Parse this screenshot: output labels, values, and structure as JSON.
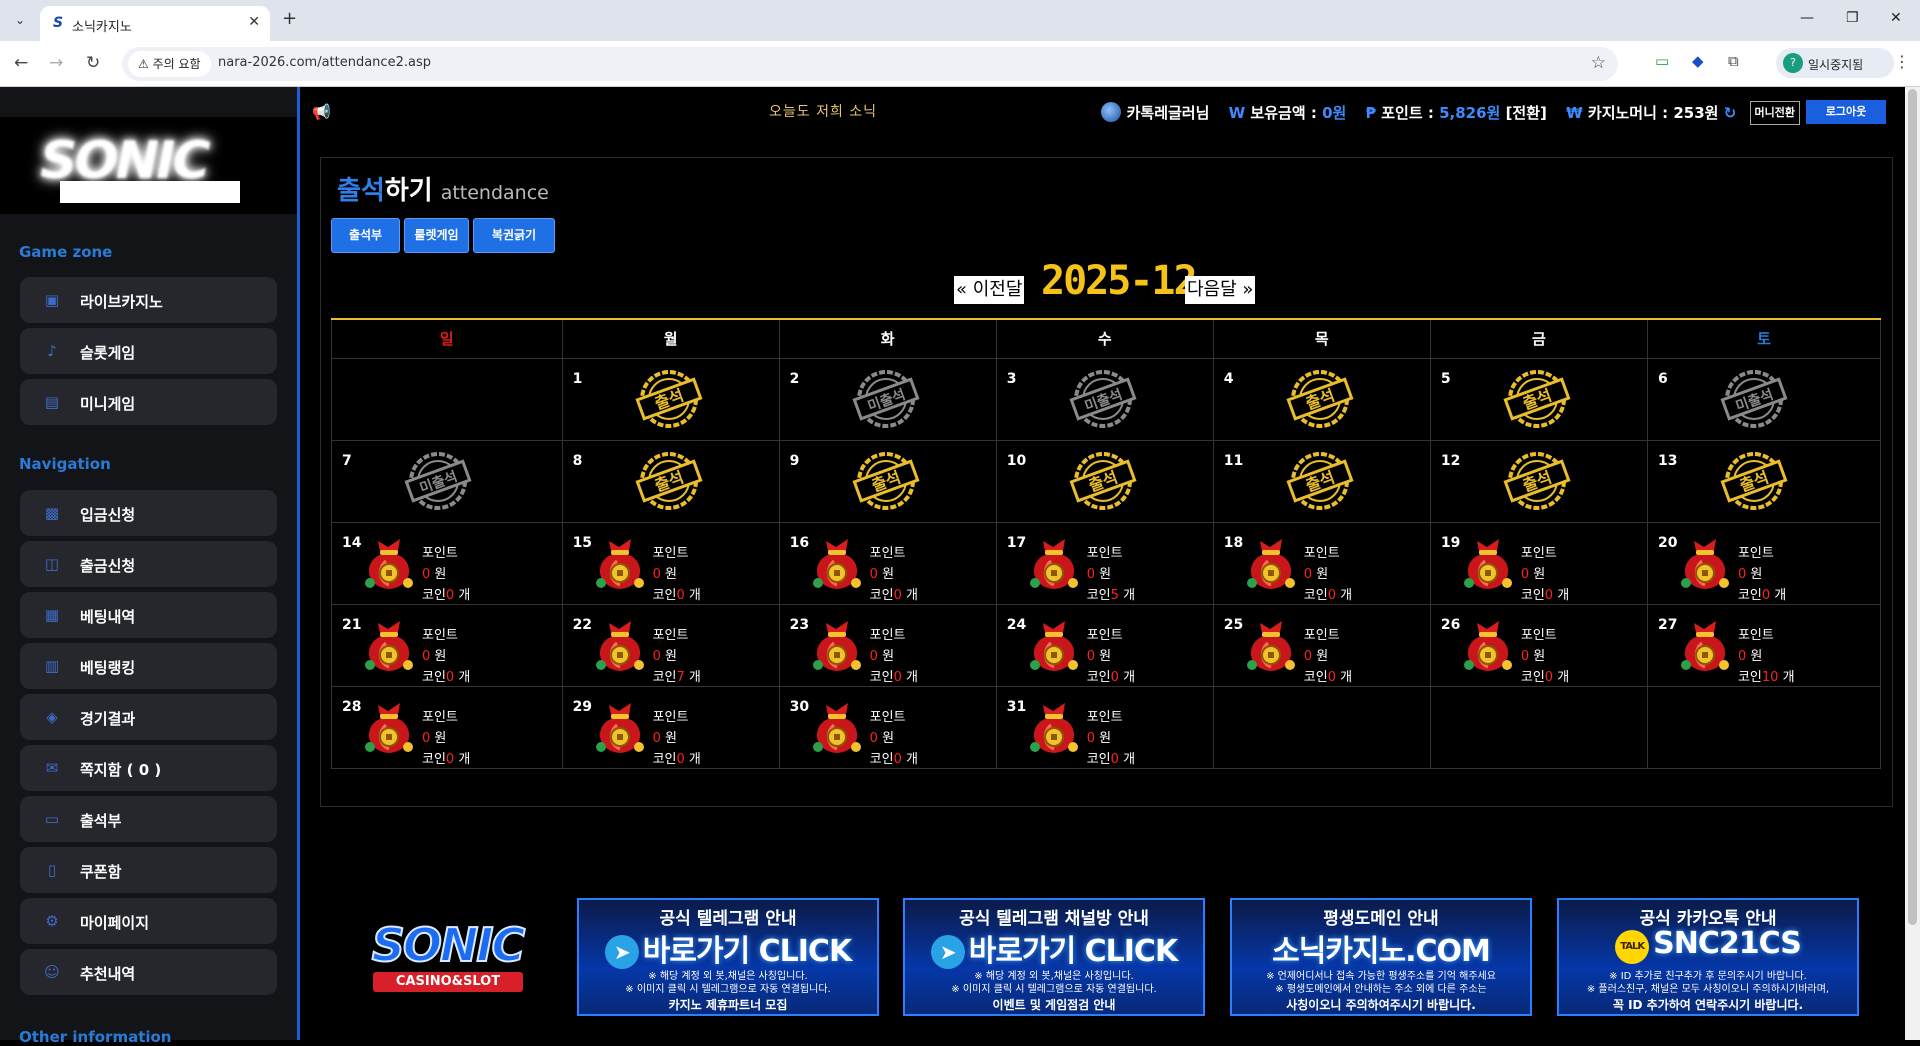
{
  "browser": {
    "tab_title": "소닉카지노",
    "tab_icon": "S",
    "security_chip": "주의 요함",
    "url": "nara-2026.com/attendance2.asp",
    "profile_initial": "?",
    "profile_label": "일시중지됨"
  },
  "topbar": {
    "marquee": "오늘도 저희 소닉",
    "username": "카톡레글러님",
    "balance_label": "보유금액 : ",
    "balance_value": "0원",
    "point_label": "포인트 : ",
    "point_value": "5,826원",
    "point_convert": "[전환]",
    "casino_money_label": "카지노머니 : ",
    "casino_money_value": "253원",
    "money_convert_button": "머니전환",
    "logout_button": "로그아웃"
  },
  "sidebar": {
    "sections": [
      {
        "title": "Game zone",
        "items": [
          {
            "label": "라이브카지노",
            "icon": "casino-card-icon",
            "glyph": "▣"
          },
          {
            "label": "슬롯게임",
            "icon": "slot-lever-icon",
            "glyph": "♪"
          },
          {
            "label": "미니게임",
            "icon": "mini-game-icon",
            "glyph": "▤"
          }
        ]
      },
      {
        "title": "Navigation",
        "items": [
          {
            "label": "입금신청",
            "icon": "deposit-icon",
            "glyph": "▩"
          },
          {
            "label": "출금신청",
            "icon": "withdraw-icon",
            "glyph": "◫"
          },
          {
            "label": "베팅내역",
            "icon": "bet-history-icon",
            "glyph": "▦"
          },
          {
            "label": "베팅랭킹",
            "icon": "ranking-icon",
            "glyph": "▥"
          },
          {
            "label": "경기결과",
            "icon": "trophy-icon",
            "glyph": "◈"
          },
          {
            "label": "쪽지함 ( 0 )",
            "icon": "message-icon",
            "glyph": "✉"
          },
          {
            "label": "출석부",
            "icon": "calendar-icon",
            "glyph": "▭"
          },
          {
            "label": "쿠폰함",
            "icon": "coupon-icon",
            "glyph": "▯"
          },
          {
            "label": "마이페이지",
            "icon": "gear-icon",
            "glyph": "⚙"
          },
          {
            "label": "추천내역",
            "icon": "user-add-icon",
            "glyph": "☺"
          }
        ]
      },
      {
        "title": "Other information",
        "items": []
      }
    ]
  },
  "page": {
    "title_blue": "출석",
    "title_white": "하기",
    "title_sub": "attendance",
    "tabs": [
      "출석부",
      "룰렛게임",
      "복권긁기"
    ],
    "prev_month": "« 이전달",
    "next_month": "다음달 »",
    "month": "2025-12"
  },
  "calendar": {
    "weekdays": [
      "일",
      "월",
      "화",
      "수",
      "목",
      "금",
      "토"
    ],
    "stamp_attended": "출석",
    "stamp_absent": "미출석",
    "point_label": "포인트",
    "won_unit": "원",
    "coin_label": "코인",
    "coin_unit": "개",
    "weeks": [
      [
        null,
        {
          "day": 1,
          "stamp": "attended"
        },
        {
          "day": 2,
          "stamp": "absent"
        },
        {
          "day": 3,
          "stamp": "absent"
        },
        {
          "day": 4,
          "stamp": "attended"
        },
        {
          "day": 5,
          "stamp": "attended"
        },
        {
          "day": 6,
          "stamp": "absent"
        }
      ],
      [
        {
          "day": 7,
          "stamp": "absent"
        },
        {
          "day": 8,
          "stamp": "attended"
        },
        {
          "day": 9,
          "stamp": "attended"
        },
        {
          "day": 10,
          "stamp": "attended"
        },
        {
          "day": 11,
          "stamp": "attended"
        },
        {
          "day": 12,
          "stamp": "attended"
        },
        {
          "day": 13,
          "stamp": "attended"
        }
      ],
      [
        {
          "day": 14,
          "points": "0",
          "coins": "0"
        },
        {
          "day": 15,
          "points": "0",
          "coins": "0"
        },
        {
          "day": 16,
          "points": "0",
          "coins": "0"
        },
        {
          "day": 17,
          "points": "0",
          "coins": "5"
        },
        {
          "day": 18,
          "points": "0",
          "coins": "0"
        },
        {
          "day": 19,
          "points": "0",
          "coins": "0"
        },
        {
          "day": 20,
          "points": "0",
          "coins": "0"
        }
      ],
      [
        {
          "day": 21,
          "points": "0",
          "coins": "0"
        },
        {
          "day": 22,
          "points": "0",
          "coins": "7"
        },
        {
          "day": 23,
          "points": "0",
          "coins": "0"
        },
        {
          "day": 24,
          "points": "0",
          "coins": "0"
        },
        {
          "day": 25,
          "points": "0",
          "coins": "0"
        },
        {
          "day": 26,
          "points": "0",
          "coins": "0"
        },
        {
          "day": 27,
          "points": "0",
          "coins": "10"
        }
      ],
      [
        {
          "day": 28,
          "points": "0",
          "coins": "0"
        },
        {
          "day": 29,
          "points": "0",
          "coins": "0"
        },
        {
          "day": 30,
          "points": "0",
          "coins": "0"
        },
        {
          "day": 31,
          "points": "0",
          "coins": "0"
        },
        null,
        null,
        null
      ]
    ]
  },
  "footer": {
    "brand": "SONIC",
    "brand_sub": "CASINO&SLOT",
    "banners": [
      {
        "title": "공식 텔레그램 안내",
        "main": "바로가기 CLICK",
        "icon": "telegram-icon",
        "note1": "※ 해당 계정 외 봇,채널은 사칭입니다.",
        "note2": "※ 이미지 클릭 시 텔레그램으로 자동 연결됩니다.",
        "footer": "카지노 제휴파트너 모집"
      },
      {
        "title": "공식 텔레그램 채널방 안내",
        "main": "바로가기 CLICK",
        "icon": "telegram-icon",
        "note1": "※ 해당 계정 외 봇,채널은 사칭입니다.",
        "note2": "※ 이미지 클릭 시 텔레그램으로 자동 연결됩니다.",
        "footer": "이벤트 및 게임점검 안내"
      },
      {
        "title": "평생도메인 안내",
        "main": "소닉카지노.COM",
        "icon": "",
        "note1": "※ 언제어디서나 접속 가능한 평생주소를 기억 해주세요",
        "note2": "※ 평생도메인에서 안내하는 주소 외에 다른 주소는",
        "footer": "사칭이오니 주의하여주시기 바랍니다."
      },
      {
        "title": "공식 카카오톡 안내",
        "main": "SNC21CS",
        "icon": "kakao-talk-icon",
        "note1": "※ ID 추가로 친구추가 후 문의주시기 바랍니다.",
        "note2": "※ 플러스친구, 채널은 모두 사칭이오니 주의하시기바라며,",
        "footer": "꼭 ID 추가하여 연락주시기 바랍니다."
      }
    ]
  },
  "colors": {
    "accent_blue": "#1f6fe5",
    "gold": "#e9bd2b",
    "stamp_gray": "#8a8a8a",
    "red_value": "#ff2020"
  }
}
